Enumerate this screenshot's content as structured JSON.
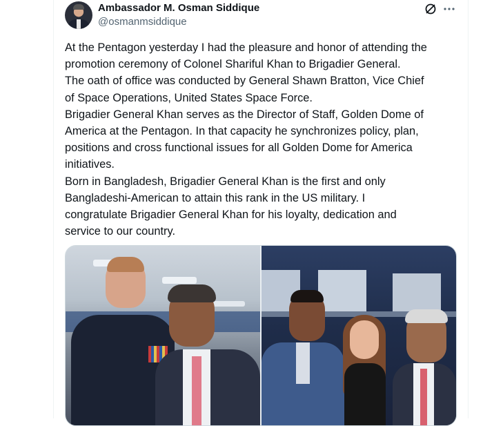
{
  "author": {
    "display_name": "Ambassador M. Osman Siddique",
    "handle": "@osmanmsiddique"
  },
  "icons": {
    "grok": "grok-icon",
    "more": "more-icon"
  },
  "tweet": {
    "lines": [
      "At the Pentagon yesterday I had the pleasure and honor of attending the",
      "promotion ceremony of Colonel Shariful Khan to Brigadier General.",
      "The oath of office was conducted by General Shawn Bratton, Vice Chief",
      "of Space Operations, United States Space Force.",
      "Brigadier General Khan serves as the Director of Staff, Golden Dome of",
      "America at the Pentagon. In that capacity he synchronizes policy, plan,",
      "positions and cross functional issues for all Golden Dome for America",
      "initiatives.",
      "Born in Bangladesh, Brigadier General Khan is the first and only",
      "Bangladeshi-American to attain this rank in the US military. I",
      "congratulate Brigadier General Khan for his loyalty, dedication and",
      "service to our country."
    ]
  },
  "colors": {
    "text": "#0f1419",
    "secondary": "#536471",
    "border": "#cfd9de"
  }
}
